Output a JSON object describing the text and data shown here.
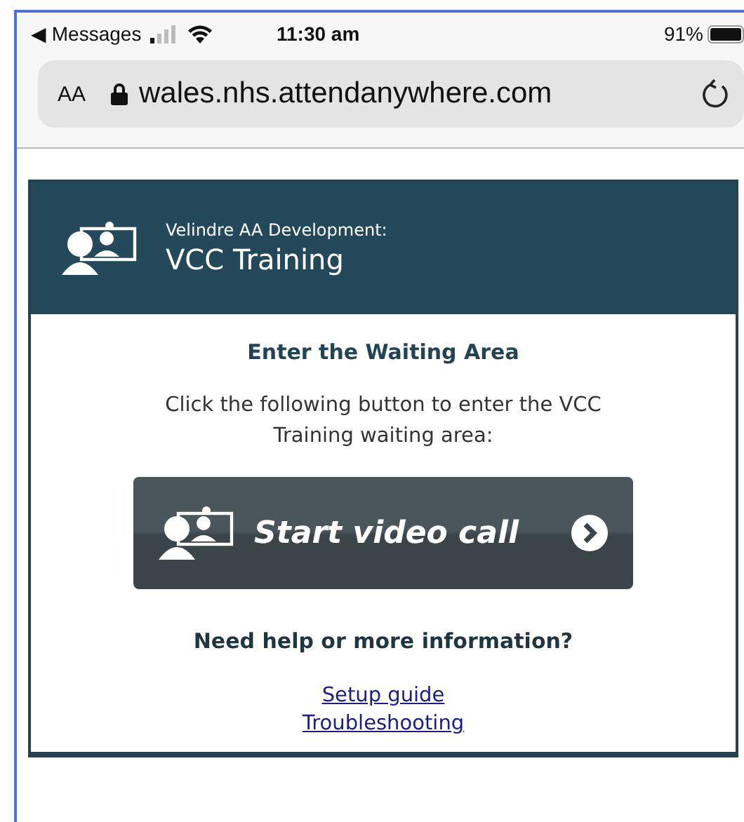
{
  "status_bar": {
    "back_label": "◀ Messages",
    "time": "11:30 am",
    "battery": "91%"
  },
  "address_bar": {
    "text_size": "AA",
    "url": "wales.nhs.attendanywhere.com"
  },
  "card": {
    "subtitle": "Velindre AA Development:",
    "title": "VCC Training",
    "heading": "Enter the Waiting Area",
    "instructions": "Click the following button to enter the VCC Training waiting area:",
    "button": "Start video call",
    "help_heading": "Need help or more information?",
    "links": [
      "Setup guide",
      "Troubleshooting"
    ]
  }
}
